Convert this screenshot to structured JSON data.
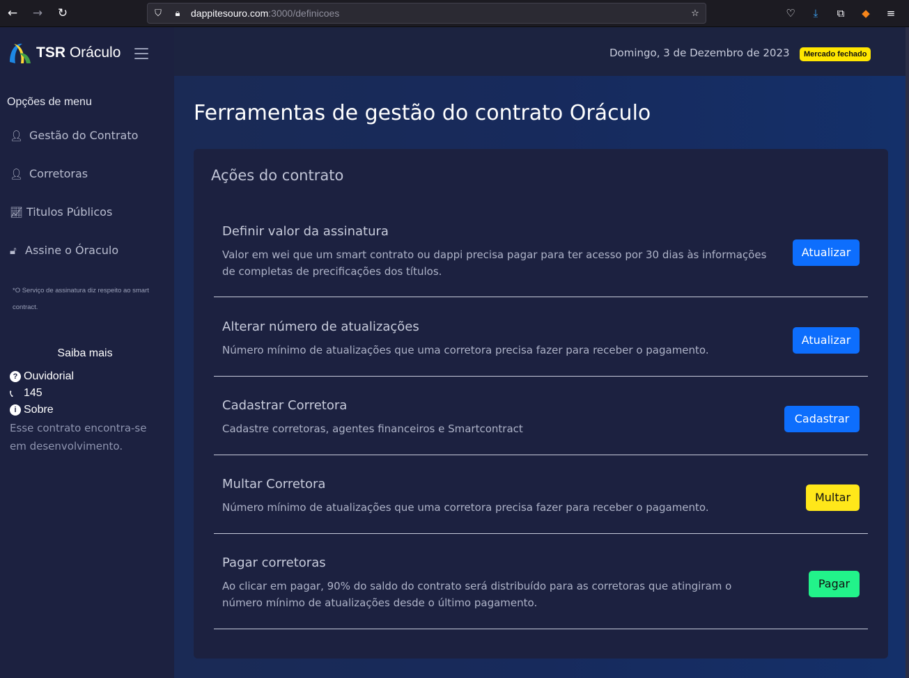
{
  "browser": {
    "url_host": "dappitesouro.com",
    "url_path": ":3000/definicoes"
  },
  "sidebar": {
    "logo_bold": "TSR",
    "logo_light": "Oráculo",
    "menu_title": "Opções de menu",
    "items": [
      {
        "label": "Gestão do Contrato",
        "icon": "user-gear-icon"
      },
      {
        "label": "Corretoras",
        "icon": "user-gear-icon"
      },
      {
        "label": "Titulos Públicos",
        "icon": "chart-line-icon"
      },
      {
        "label": "Assine o Óraculo",
        "icon": "lock-open-icon"
      }
    ],
    "note": "*O Serviço de assinatura diz respeito ao smart contract.",
    "saiba_title": "Saiba mais",
    "ouvidorial": "Ouvidorial",
    "phone": "145",
    "sobre": "Sobre",
    "sobre_desc": "Esse contrato encontra-se em desenvolvimento."
  },
  "header": {
    "date": "Domingo, 3 de Dezembro de 2023",
    "market_status": "Mercado fechado"
  },
  "main": {
    "page_title": "Ferramentas de gestão do contrato Oráculo",
    "card_title": "Ações do contrato",
    "actions": [
      {
        "title": "Definir valor da assinatura",
        "desc": "Valor em wei que um smart contrato ou dappi precisa pagar para ter acesso por 30 dias às informações de completas de precificações dos títulos.",
        "button": "Atualizar"
      },
      {
        "title": "Alterar número de atualizações",
        "desc": "Número mínimo de atualizações que uma corretora precisa fazer para receber o pagamento.",
        "button": "Atualizar"
      },
      {
        "title": "Cadastrar Corretora",
        "desc": "Cadastre corretoras, agentes financeiros e Smartcontract",
        "button": "Cadastrar"
      },
      {
        "title": "Multar Corretora",
        "desc": "Número mínimo de atualizações que uma corretora precisa fazer para receber o pagamento.",
        "button": "Multar"
      },
      {
        "title": "Pagar corretoras",
        "desc": "Ao clicar em pagar, 90% do saldo do contrato será distribuído para as corretoras que atingiram o número mínimo de atualizações desde o último pagamento.",
        "button": "Pagar"
      }
    ]
  },
  "colors": {
    "primary_button": "#0d6efd",
    "warning_button": "#ffe71a",
    "success_button": "#22f28a",
    "badge": "#ffe600"
  }
}
